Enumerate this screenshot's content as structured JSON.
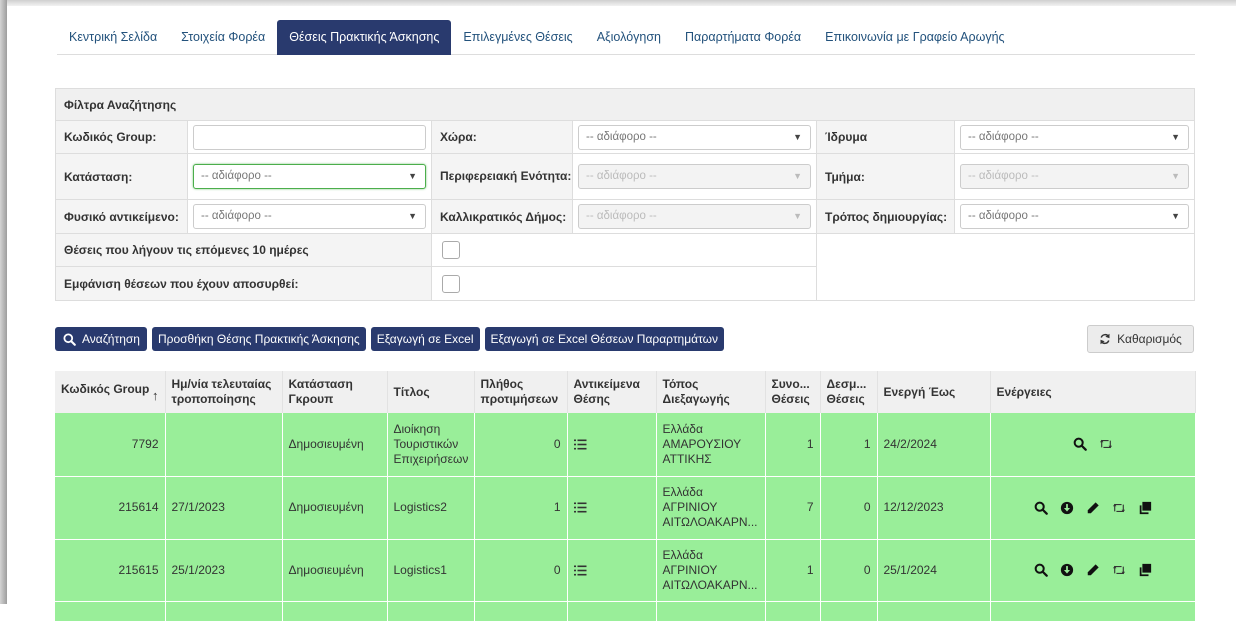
{
  "nav": {
    "tabs": [
      {
        "label": "Κεντρική Σελίδα"
      },
      {
        "label": "Στοιχεία Φορέα"
      },
      {
        "label": "Θέσεις Πρακτικής Άσκησης"
      },
      {
        "label": "Επιλεγμένες Θέσεις"
      },
      {
        "label": "Αξιολόγηση"
      },
      {
        "label": "Παραρτήματα Φορέα"
      },
      {
        "label": "Επικοινωνία με Γραφείο Αρωγής"
      }
    ],
    "active_index": 2
  },
  "filters": {
    "title": "Φίλτρα Αναζήτησης",
    "group_code_label": "Κωδικός Group:",
    "group_code_value": "",
    "country_label": "Χώρα:",
    "country_value": "-- αδιάφορο --",
    "institution_label": "Ίδρυμα",
    "institution_value": "-- αδιάφορο --",
    "status_label": "Κατάσταση:",
    "status_value": "-- αδιάφορο --",
    "regional_unit_label": "Περιφερειακή Ενότητα:",
    "regional_unit_value": "-- αδιάφορο --",
    "department_label": "Τμήμα:",
    "department_value": "-- αδιάφορο --",
    "physical_object_label": "Φυσικό αντικείμενο:",
    "physical_object_value": "-- αδιάφορο --",
    "municipality_label": "Καλλικρατικός Δήμος:",
    "municipality_value": "-- αδιάφορο --",
    "creation_method_label": "Τρόπος δημιουργίας:",
    "creation_method_value": "-- αδιάφορο --",
    "expiring_label": "Θέσεις που λήγουν τις επόμενες 10 ημέρες",
    "withdrawn_label": "Εμφάνιση θέσεων που έχουν αποσυρθεί:"
  },
  "buttons": {
    "search": "Αναζήτηση",
    "add_position": "Προσθήκη Θέσης Πρακτικής Άσκησης",
    "export_excel": "Εξαγωγή σε Excel",
    "export_excel_annex": "Εξαγωγή σε Excel Θέσεων Παραρτημάτων",
    "clear": "Καθαρισμός"
  },
  "table": {
    "headers": {
      "group_code": "Κωδικός Group",
      "last_modified": "Ημ/νία τελευταίας τροποποίησης",
      "group_status": "Κατάσταση Γκρουπ",
      "title": "Τίτλος",
      "preferences": "Πλήθος προτιμήσεων",
      "position_object": "Αντικείμενα Θέσης",
      "location": "Τόπος Διεξαγωγής",
      "total_positions": "Συνο... Θέσεις",
      "reserved_positions": "Δεσμ... Θέσεις",
      "active_until": "Ενεργή Έως",
      "actions": "Ενέργειες"
    },
    "sort_indicator": "↑",
    "rows": [
      {
        "group_code": "7792",
        "last_modified": "",
        "status": "Δημοσιευμένη",
        "title": "Διοίκηση Τουριστικών Επιχειρήσεων",
        "preferences": "0",
        "loc1": "Ελλάδα",
        "loc2": "ΑΜΑΡΟΥΣΙΟΥ",
        "loc3": "ΑΤΤΙΚΗΣ",
        "total": "1",
        "reserved": "1",
        "active_until": "24/2/2024"
      },
      {
        "group_code": "215614",
        "last_modified": "27/1/2023",
        "status": "Δημοσιευμένη",
        "title": "Logistics2",
        "preferences": "1",
        "loc1": "Ελλάδα",
        "loc2": "ΑΓΡΙΝΙΟΥ",
        "loc3": "ΑΙΤΩΛΟΑΚΑΡΝ...",
        "total": "7",
        "reserved": "0",
        "active_until": "12/12/2023"
      },
      {
        "group_code": "215615",
        "last_modified": "25/1/2023",
        "status": "Δημοσιευμένη",
        "title": "Logistics1",
        "preferences": "0",
        "loc1": "Ελλάδα",
        "loc2": "ΑΓΡΙΝΙΟΥ",
        "loc3": "ΑΙΤΩΛΟΑΚΑΡΝ...",
        "total": "1",
        "reserved": "0",
        "active_until": "25/1/2024"
      }
    ]
  },
  "icons": {
    "list": "list-icon",
    "search": "search-icon",
    "download": "download-circle-icon",
    "edit": "pencil-icon",
    "retweet": "retweet-icon",
    "copy": "copy-icon",
    "clear": "refresh-icon"
  },
  "colors": {
    "primary": "#293a6e",
    "row_bg": "#99ee99",
    "link": "#23527c"
  }
}
